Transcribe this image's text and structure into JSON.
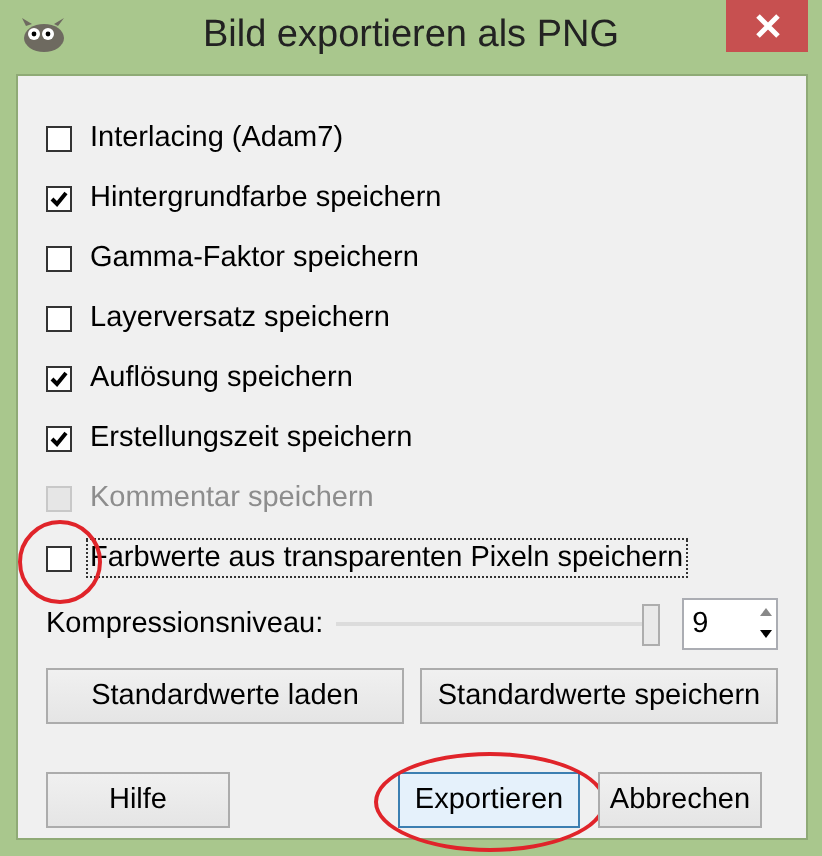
{
  "window": {
    "title": "Bild exportieren als PNG"
  },
  "options": [
    {
      "label": "Interlacing (Adam7)",
      "checked": false,
      "disabled": false,
      "focused": false,
      "circled": false
    },
    {
      "label": "Hintergrundfarbe speichern",
      "checked": true,
      "disabled": false,
      "focused": false,
      "circled": false
    },
    {
      "label": "Gamma-Faktor speichern",
      "checked": false,
      "disabled": false,
      "focused": false,
      "circled": false
    },
    {
      "label": "Layerversatz speichern",
      "checked": false,
      "disabled": false,
      "focused": false,
      "circled": false
    },
    {
      "label": "Auflösung speichern",
      "checked": true,
      "disabled": false,
      "focused": false,
      "circled": false
    },
    {
      "label": "Erstellungszeit speichern",
      "checked": true,
      "disabled": false,
      "focused": false,
      "circled": false
    },
    {
      "label": "Kommentar speichern",
      "checked": false,
      "disabled": true,
      "focused": false,
      "circled": false
    },
    {
      "label": "Farbwerte aus transparenten Pixeln speichern",
      "checked": false,
      "disabled": false,
      "focused": true,
      "circled": true
    }
  ],
  "compression": {
    "label": "Kompressionsniveau:",
    "level": 1,
    "value": "9"
  },
  "default_buttons": [
    "Standardwerte laden",
    "Standardwerte speichern"
  ],
  "buttons": [
    {
      "label": "Hilfe",
      "default": false,
      "circled": false
    },
    {
      "label": "Exportieren",
      "default": true,
      "circled": true
    },
    {
      "label": "Abbrechen",
      "default": false,
      "circled": false
    }
  ]
}
